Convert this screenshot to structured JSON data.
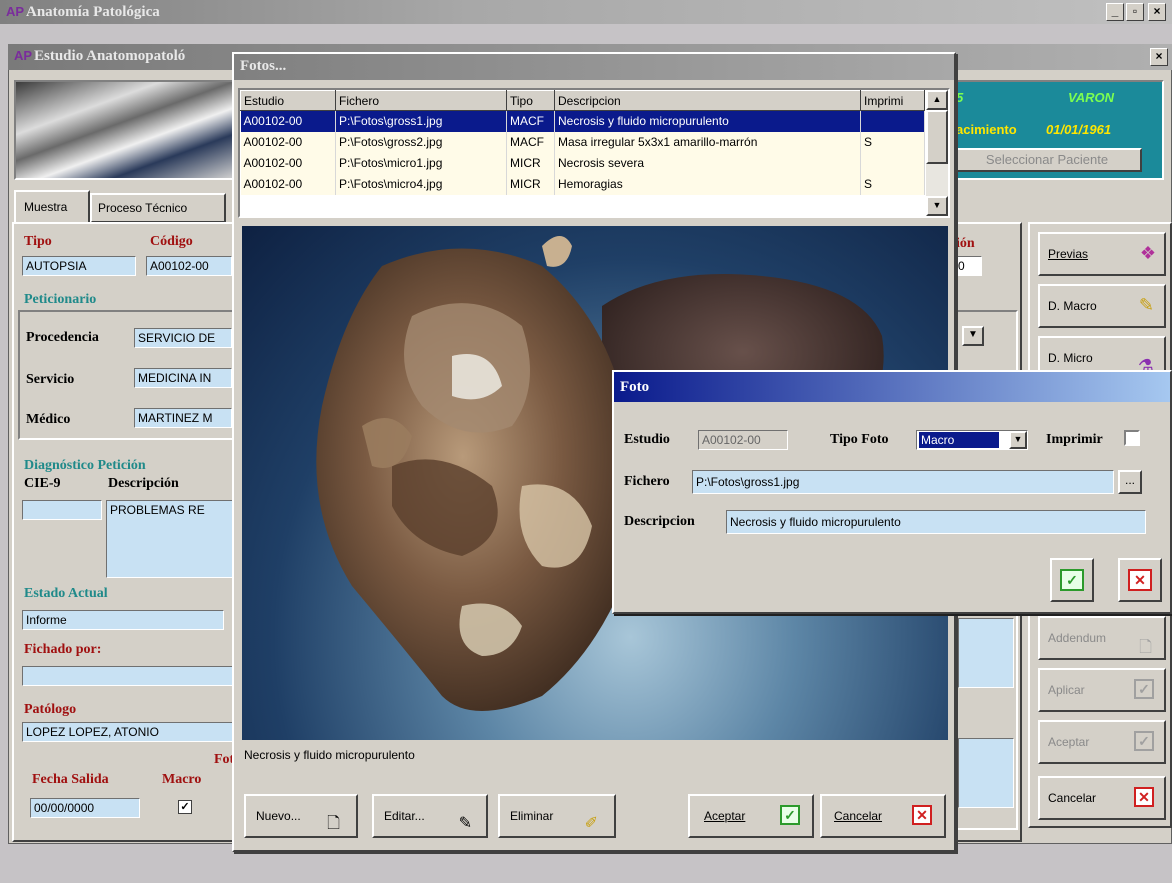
{
  "app": {
    "title": "Anatomía Patológica",
    "minimize": "_",
    "maximize": "▫",
    "close": "×"
  },
  "estudio_window": {
    "title": "Estudio Anatomopatoló",
    "close": "×"
  },
  "patient_header": {
    "sexo": "VARON",
    "nacimiento_label": "acimiento",
    "nacimiento": "01/01/1961",
    "partial_digit": "5",
    "select_button": "Seleccionar Paciente"
  },
  "tabs": [
    {
      "label": "Muestra"
    },
    {
      "label": "Proceso Técnico"
    }
  ],
  "muestra": {
    "tipo_label": "Tipo",
    "tipo_value": "AUTOPSIA",
    "codigo_label": "Código",
    "codigo_value": "A00102-00",
    "peticionario_label": "Peticionario",
    "procedencia_label": "Procedencia",
    "procedencia_value": "SERVICIO DE",
    "servicio_label": "Servicio",
    "servicio_value": "MEDICINA IN",
    "medico_label": "Médico",
    "medico_value": "MARTINEZ M",
    "diag_label": "Diagnóstico Petición",
    "cie_label": "CIE-9",
    "desc_label": "Descripción",
    "cie_value": "",
    "desc_value": "PROBLEMAS RE",
    "estado_label": "Estado Actual",
    "estado_value": "Informe",
    "fichado_label": "Fichado por:",
    "fichado_value": "",
    "patologo_label": "Patólogo",
    "patologo_value": "LOPEZ LOPEZ, ATONIO",
    "fecha_salida_label": "Fecha Salida",
    "fecha_salida_value": "00/00/0000",
    "macro_label": "Macro",
    "fot_label": "Fot",
    "macro_checked": "✓",
    "right_partial_label": "ión",
    "right_partial_value": "0"
  },
  "side_buttons": [
    {
      "label": "Previas",
      "icon": "gift-icon",
      "enabled": true
    },
    {
      "label": "D. Macro",
      "icon": "pencil-icon",
      "enabled": true
    },
    {
      "label": "D. Micro",
      "icon": "microscope-icon",
      "enabled": true
    },
    {
      "label": "Addendum",
      "icon": "document-icon",
      "enabled": false
    },
    {
      "label": "Aplicar",
      "icon": "check-icon",
      "enabled": false
    },
    {
      "label": "Aceptar",
      "icon": "check-icon",
      "enabled": false
    },
    {
      "label": "Cancelar",
      "icon": "x-icon",
      "enabled": true
    }
  ],
  "fotos_window": {
    "title": "Fotos...",
    "columns": [
      "Estudio",
      "Fichero",
      "Tipo",
      "Descripcion",
      "Imprimi"
    ],
    "rows": [
      {
        "estudio": "A00102-00",
        "fichero": "P:\\Fotos\\gross1.jpg",
        "tipo": "MACF",
        "descripcion": "Necrosis y fluido micropurulento",
        "imprimir": ""
      },
      {
        "estudio": "A00102-00",
        "fichero": "P:\\Fotos\\gross2.jpg",
        "tipo": "MACF",
        "descripcion": "Masa irregular 5x3x1 amarillo-marrón",
        "imprimir": "S"
      },
      {
        "estudio": "A00102-00",
        "fichero": "P:\\Fotos\\micro1.jpg",
        "tipo": "MICR",
        "descripcion": "Necrosis severa",
        "imprimir": ""
      },
      {
        "estudio": "A00102-00",
        "fichero": "P:\\Fotos\\micro4.jpg",
        "tipo": "MICR",
        "descripcion": "Hemoragias",
        "imprimir": "S"
      }
    ],
    "caption": "Necrosis y fluido micropurulento",
    "buttons": {
      "nuevo": "Nuevo...",
      "editar": "Editar...",
      "eliminar": "Eliminar",
      "aceptar": "Aceptar",
      "cancelar": "Cancelar"
    }
  },
  "foto_dialog": {
    "title": "Foto",
    "estudio_label": "Estudio",
    "estudio_value": "A00102-00",
    "tipo_foto_label": "Tipo Foto",
    "tipo_foto_value": "Macro",
    "imprimir_label": "Imprimir",
    "fichero_label": "Fichero",
    "fichero_value": "P:\\Fotos\\gross1.jpg",
    "browse_label": "...",
    "descripcion_label": "Descripcion",
    "descripcion_value": "Necrosis y fluido micropurulento"
  },
  "colors": {
    "selection": "#0a1a8c",
    "field": "#c8e1f3",
    "accent_green": "#2c9a2c",
    "accent_red": "#d02020",
    "header_teal": "#1b8a9a"
  }
}
